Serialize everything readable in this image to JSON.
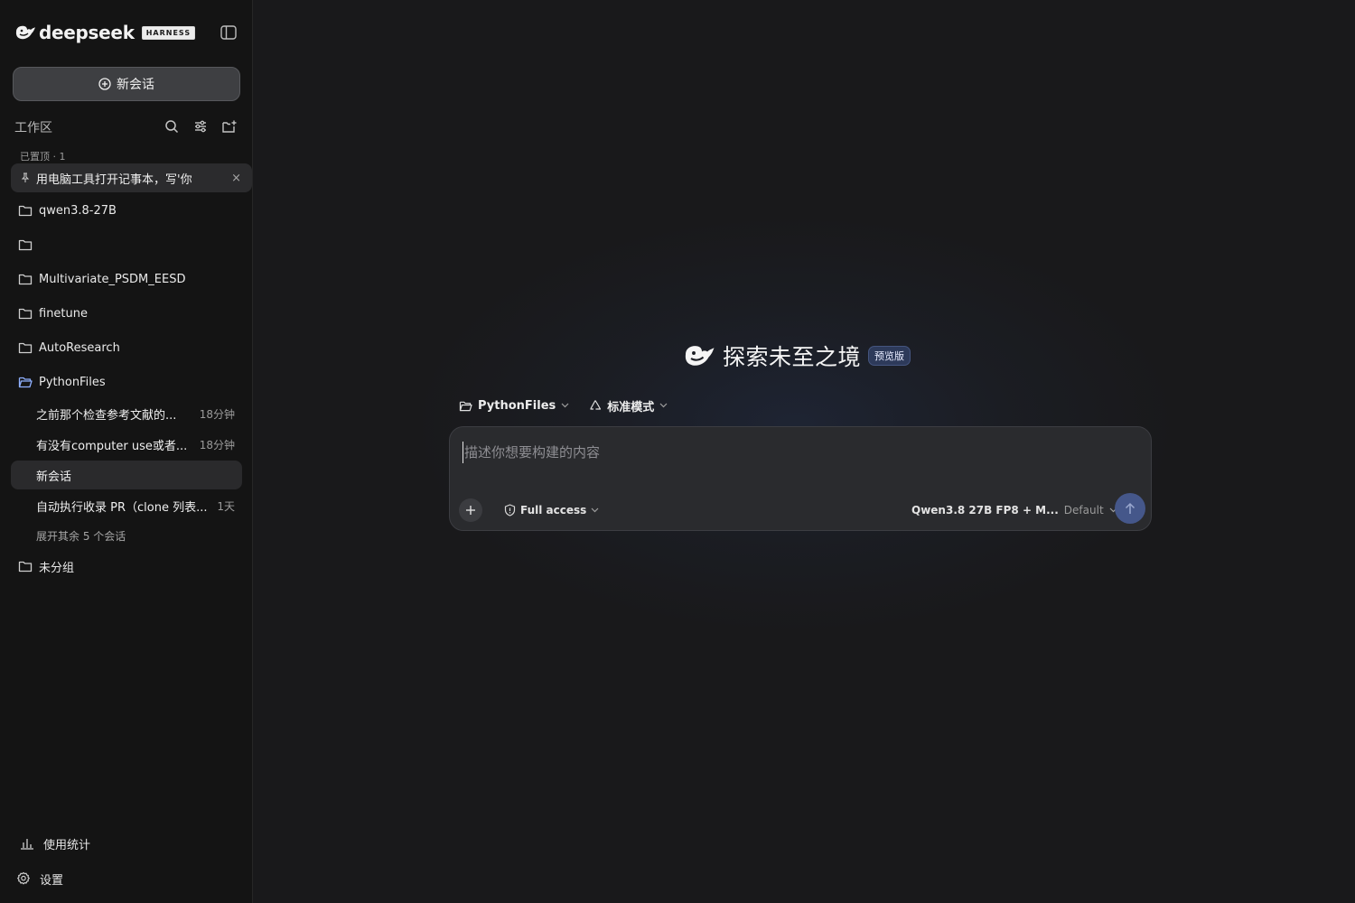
{
  "brand": {
    "name": "deepseek",
    "badge": "HARNESS"
  },
  "sidebar": {
    "new_chat_label": "新会话",
    "workspace_label": "工作区",
    "pinned_caption": "已置顶 · 1",
    "pinned_chat": "用电脑工具打开记事本，写'你",
    "folders": [
      {
        "label": "qwen3.8-27B"
      },
      {
        "label": ""
      },
      {
        "label": "Multivariate_PSDM_EESD"
      },
      {
        "label": "finetune"
      },
      {
        "label": "AutoResearch"
      },
      {
        "label": "PythonFiles",
        "open": true
      }
    ],
    "python_chats": [
      {
        "title": "之前那个检查参考文献的...",
        "time": "18分钟"
      },
      {
        "title": "有没有computer use或者...",
        "time": "18分钟"
      },
      {
        "title": "新会话",
        "time": "",
        "active": true
      },
      {
        "title": "自动执行收录 PR（clone 列表...",
        "time": "1天"
      }
    ],
    "expand_more": "展开其余 5 个会话",
    "ungrouped_label": "未分组",
    "usage_label": "使用统计",
    "settings_label": "设置"
  },
  "main": {
    "hero_title": "探索未至之境",
    "hero_badge": "预览版",
    "folder_selector": "PythonFiles",
    "mode_selector": "标准模式",
    "composer_placeholder": "描述你想要构建的内容",
    "access_label": "Full access",
    "model_label": "Qwen3.8 27B FP8 + M...",
    "effort_label": "Default"
  },
  "colors": {
    "sidebar_bg": "#141414",
    "main_bg": "#19191b",
    "accent": "#45578a",
    "active_folder_icon": "#8fb0ff"
  },
  "icons": [
    "whale-logo-icon",
    "sidebar-toggle-icon",
    "plus-circle-icon",
    "search-icon",
    "filter-icon",
    "new-folder-icon",
    "pin-icon",
    "close-icon",
    "folder-icon",
    "folder-open-icon",
    "bar-chart-icon",
    "gear-icon",
    "chevron-down-icon",
    "recycle-icon",
    "plus-icon",
    "shield-icon",
    "arrow-up-icon"
  ]
}
